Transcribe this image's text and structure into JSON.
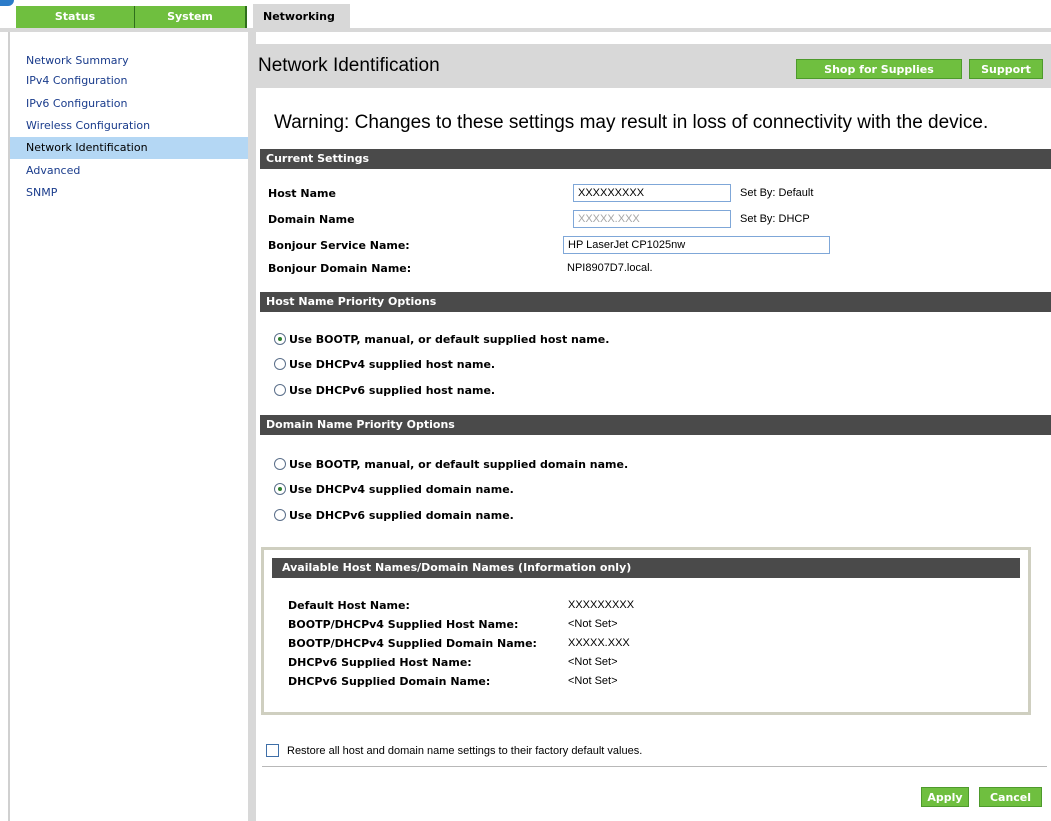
{
  "tabs": {
    "status": "Status",
    "system": "System",
    "networking": "Networking"
  },
  "sidebar": {
    "items": [
      {
        "label": "Network Summary"
      },
      {
        "label": "IPv4 Configuration"
      },
      {
        "label": "IPv6 Configuration"
      },
      {
        "label": "Wireless Configuration"
      },
      {
        "label": "Network Identification"
      },
      {
        "label": "Advanced"
      },
      {
        "label": "SNMP"
      }
    ]
  },
  "header": {
    "title": "Network Identification",
    "shop_button": "Shop for Supplies",
    "support_button": "Support"
  },
  "warning": "Warning: Changes to these settings may result in loss of connectivity with the device.",
  "current_settings": {
    "title": "Current Settings",
    "host_name_label": "Host Name",
    "host_name_value": "XXXXXXXXX",
    "host_set_by": "Set By: Default",
    "domain_name_label": "Domain Name",
    "domain_name_placeholder": "XXXXX.XXX",
    "domain_set_by": "Set By: DHCP",
    "bonjour_service_label": "Bonjour Service Name:",
    "bonjour_service_value": "HP LaserJet CP1025nw",
    "bonjour_domain_label": "Bonjour Domain Name:",
    "bonjour_domain_value": "NPI8907D7.local."
  },
  "host_priority": {
    "title": "Host Name Priority Options",
    "options": [
      "Use BOOTP, manual, or default supplied host name.",
      "Use DHCPv4 supplied host name.",
      "Use DHCPv6 supplied host name."
    ],
    "selected": 0
  },
  "domain_priority": {
    "title": "Domain Name Priority Options",
    "options": [
      "Use BOOTP, manual, or default supplied domain name.",
      "Use DHCPv4 supplied domain name.",
      "Use DHCPv6 supplied domain name."
    ],
    "selected": 1
  },
  "available_names": {
    "title": "Available Host Names/Domain Names (Information only)",
    "rows": [
      {
        "label": "Default Host Name:",
        "value": "XXXXXXXXX"
      },
      {
        "label": "BOOTP/DHCPv4 Supplied Host Name:",
        "value": "<Not Set>"
      },
      {
        "label": "BOOTP/DHCPv4 Supplied Domain Name:",
        "value": "XXXXX.XXX"
      },
      {
        "label": "DHCPv6 Supplied Host Name:",
        "value": "<Not Set>"
      },
      {
        "label": "DHCPv6 Supplied Domain Name:",
        "value": "<Not Set>"
      }
    ]
  },
  "restore_label": "Restore all host and domain name settings to their factory default values.",
  "footer": {
    "apply": "Apply",
    "cancel": "Cancel"
  },
  "colors": {
    "tab_green": "#6fbf3f",
    "section_dark": "#4a4a4a",
    "active_side": "#b4d7f4",
    "link_blue": "#1a3c8c"
  }
}
